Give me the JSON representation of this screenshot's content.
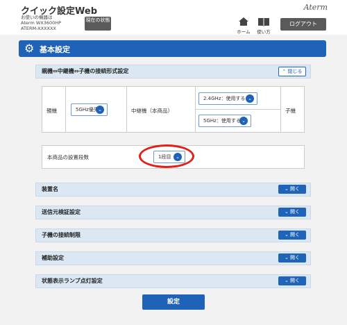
{
  "header": {
    "title": "クイック設定Web",
    "device_line": "お使いの機器は",
    "model": "Aterm WX3600HP",
    "id": "ATERM-XXXXXX",
    "status_button": "現在の状態",
    "home_label": "ホーム",
    "help_label": "使い方",
    "logout_label": "ログアウト",
    "brand": "Aterm"
  },
  "main": {
    "title": "基本設定"
  },
  "connection": {
    "title": "親機⇔中継機⇔子機の接続形式設定",
    "close_label": "閉じる",
    "parent_label": "親機",
    "parent_select": "5GHz優先",
    "relay_label": "中継機（本商品）",
    "relay_24": "2.4GHz：使用する",
    "relay_5": "5GHz：使用する",
    "child_label": "子機"
  },
  "install": {
    "label": "本商品の設置段数",
    "value": "1段目"
  },
  "sections": [
    {
      "title": "装置名",
      "open_label": "開く"
    },
    {
      "title": "送信元検証設定",
      "open_label": "開く"
    },
    {
      "title": "子機の接続制限",
      "open_label": "開く"
    },
    {
      "title": "補助設定",
      "open_label": "開く"
    },
    {
      "title": "状態表示ランプ点灯設定",
      "open_label": "開く"
    }
  ],
  "submit_label": "設定"
}
